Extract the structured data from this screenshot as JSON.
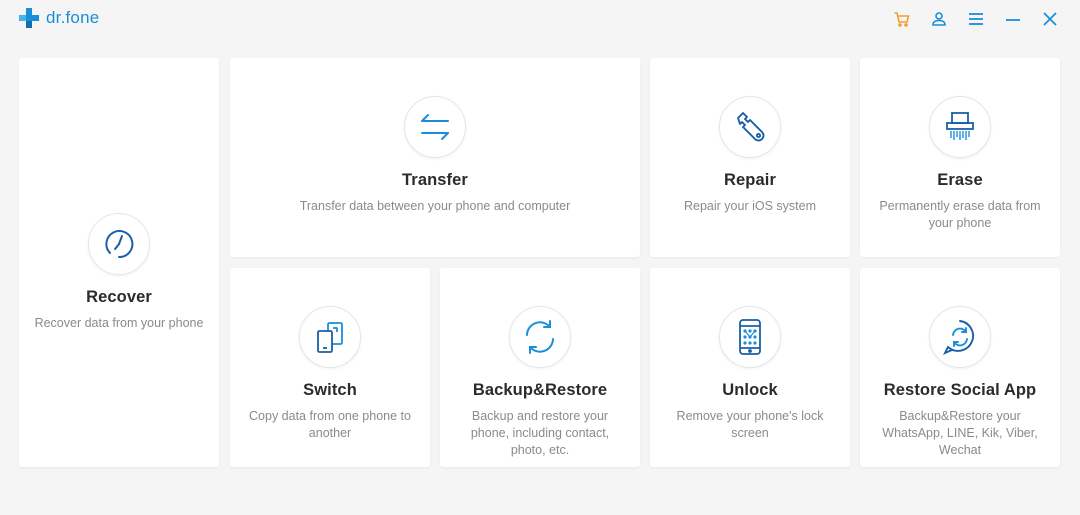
{
  "app": {
    "name": "dr.fone",
    "brand_color": "#1a8fd8",
    "cart_color": "#f0a030"
  },
  "window_controls": [
    "cart-icon",
    "account-icon",
    "menu-icon",
    "minimize-icon",
    "close-icon"
  ],
  "cards": {
    "recover": {
      "title": "Recover",
      "desc": "Recover data from your phone",
      "icon": "clock-icon"
    },
    "transfer": {
      "title": "Transfer",
      "desc": "Transfer data between your phone and computer",
      "icon": "transfer-arrows-icon"
    },
    "repair": {
      "title": "Repair",
      "desc": "Repair your iOS system",
      "icon": "wrench-icon"
    },
    "erase": {
      "title": "Erase",
      "desc": "Permanently erase data from your phone",
      "icon": "shredder-icon"
    },
    "switch": {
      "title": "Switch",
      "desc": "Copy data from one phone to another",
      "icon": "phone-switch-icon"
    },
    "backup": {
      "title": "Backup&Restore",
      "desc": "Backup and restore your phone, including contact, photo, etc.",
      "icon": "sync-icon"
    },
    "unlock": {
      "title": "Unlock",
      "desc": "Remove your phone's lock screen",
      "icon": "phone-lock-icon"
    },
    "social": {
      "title": "Restore Social App",
      "desc": "Backup&Restore your WhatsApp, LINE, Kik, Viber, Wechat",
      "icon": "chat-sync-icon"
    }
  }
}
